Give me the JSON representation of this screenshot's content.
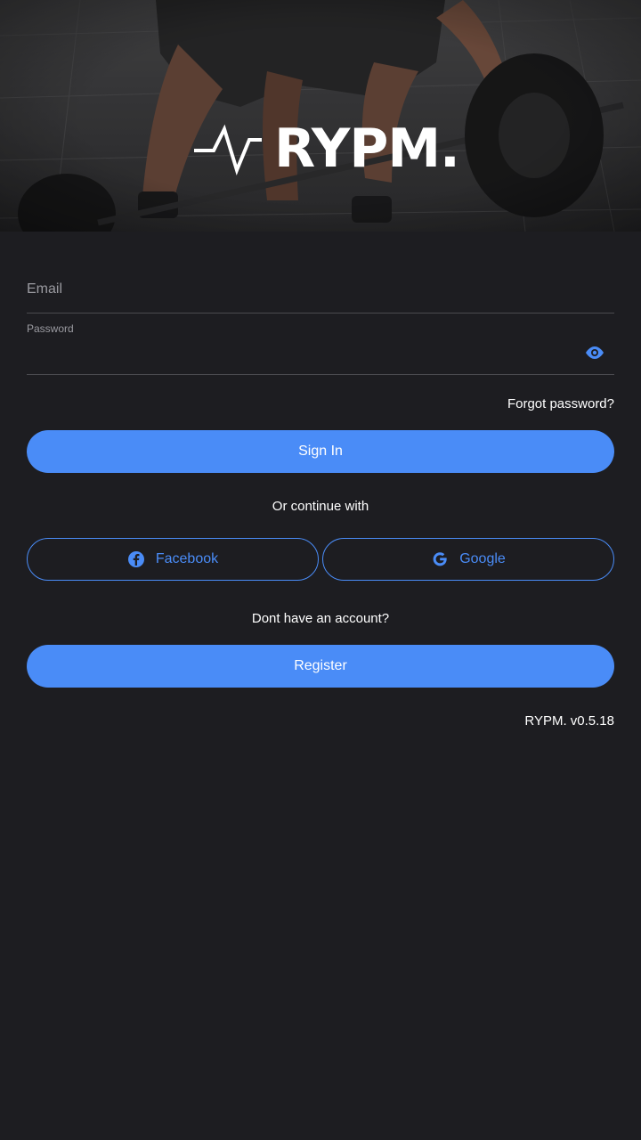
{
  "brand": {
    "name": "RYPM."
  },
  "login": {
    "email_placeholder": "Email",
    "password_label": "Password",
    "forgot_label": "Forgot password?",
    "signin_label": "Sign In"
  },
  "social": {
    "divider_text": "Or continue with",
    "facebook_label": "Facebook",
    "google_label": "Google"
  },
  "signup": {
    "prompt": "Dont have an account?",
    "register_label": "Register"
  },
  "footer": {
    "version": "RYPM. v0.5.18"
  },
  "icons": {
    "pulse": "pulse-logo-icon",
    "eye": "eye-icon",
    "facebook": "facebook-icon",
    "google": "google-icon"
  },
  "colors": {
    "background": "#1d1d21",
    "accent": "#4a8cf7",
    "text": "#ffffff",
    "muted": "#9a9aa0"
  }
}
